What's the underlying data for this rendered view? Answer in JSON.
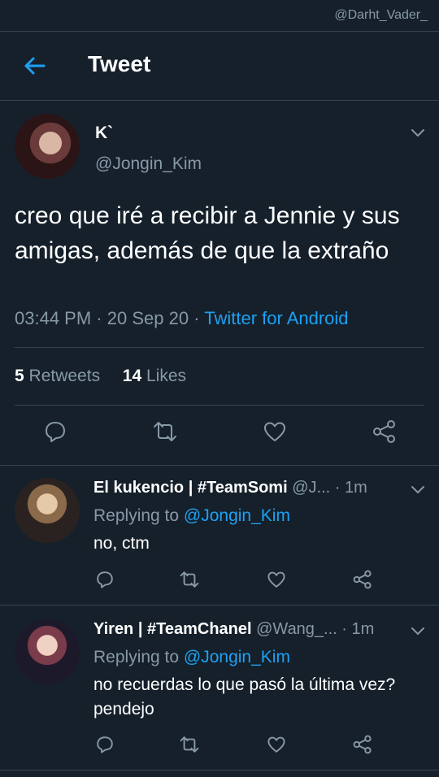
{
  "watermark": "@Darht_Vader_",
  "header": {
    "title": "Tweet"
  },
  "tweet": {
    "author_name": "K`",
    "author_handle": "@Jongin_Kim",
    "text": "creo que iré a recibir a Jennie y sus amigas, además de que la extraño",
    "time": "03:44 PM",
    "date": "20 Sep 20",
    "source": "Twitter for Android",
    "retweets_count": "5",
    "retweets_label": "Retweets",
    "likes_count": "14",
    "likes_label": "Likes"
  },
  "replies": [
    {
      "name": "El kukencio | #TeamSomi",
      "handle": "@J...",
      "time": "1m",
      "replying_prefix": "Replying to",
      "replying_to": "@Jongin_Kim",
      "text": "no, ctm"
    },
    {
      "name": "Yiren | #TeamChanel",
      "handle": "@Wang_...",
      "time": "1m",
      "replying_prefix": "Replying to",
      "replying_to": "@Jongin_Kim",
      "text": "no recuerdas lo que pasó la última vez? pendejo"
    }
  ],
  "colors": {
    "background": "#15202b",
    "accent": "#1da1f2",
    "secondary_text": "#8899a6",
    "divider": "#38444d"
  },
  "icons": [
    "back-arrow-icon",
    "chevron-down-icon",
    "reply-icon",
    "retweet-icon",
    "like-icon",
    "share-icon"
  ]
}
